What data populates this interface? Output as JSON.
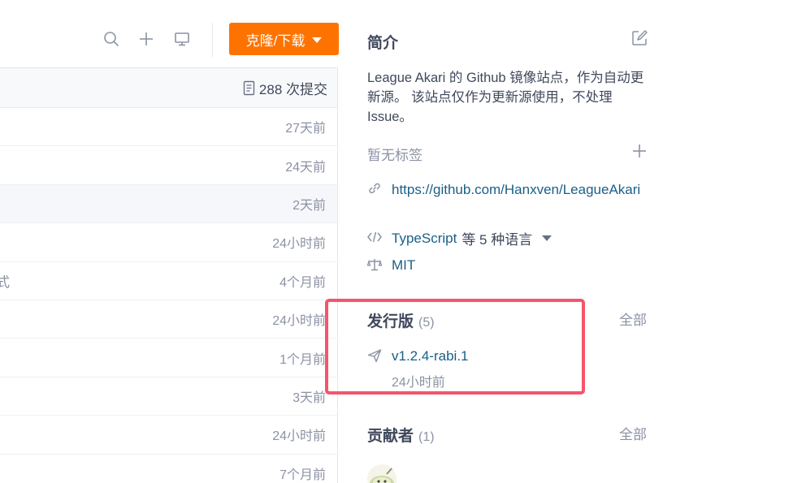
{
  "toolbar": {
    "icons": [
      "search-icon",
      "plus-icon",
      "monitor-icon"
    ],
    "clone_label": "克隆/下载",
    "accent_color": "#fe7300"
  },
  "commits": {
    "count_label": "288 次提交",
    "rows": [
      {
        "message": "",
        "time": "27天前"
      },
      {
        "message": "",
        "time": "24天前"
      },
      {
        "message": "",
        "time": "2天前"
      },
      {
        "message": "",
        "time": "24小时前"
      },
      {
        "message": "式",
        "time": "4个月前"
      },
      {
        "message": "",
        "time": "24小时前"
      },
      {
        "message": "",
        "time": "1个月前"
      },
      {
        "message": "",
        "time": "3天前"
      },
      {
        "message": "",
        "time": "24小时前"
      },
      {
        "message": "",
        "time": "7个月前"
      }
    ]
  },
  "intro": {
    "title": "简介",
    "description": "League Akari 的 Github 镜像站点，作为自动更新源。 该站点仅作为更新源使用，不处理 Issue。",
    "no_tags": "暂无标签",
    "repo_url": "https://github.com/Hanxven/LeagueAkari",
    "language_main": "TypeScript",
    "language_rest": "等 5 种语言",
    "license": "MIT"
  },
  "releases": {
    "title": "发行版",
    "count": "(5)",
    "all_label": "全部",
    "latest_tag": "v1.2.4-rabi.1",
    "latest_time": "24小时前",
    "highlight_color": "#f4566b"
  },
  "contributors": {
    "title": "贡献者",
    "count": "(1)",
    "all_label": "全部"
  }
}
